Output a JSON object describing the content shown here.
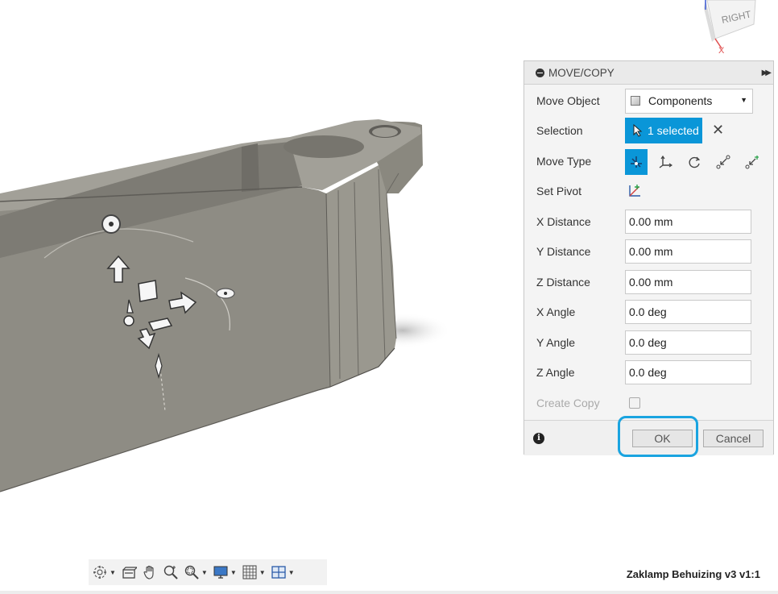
{
  "viewcube": {
    "face_label": "RIGHT",
    "axis_label": "X"
  },
  "dialog": {
    "title": "MOVE/COPY",
    "move_object": {
      "label": "Move Object",
      "value": "Components"
    },
    "selection": {
      "label": "Selection",
      "value": "1 selected"
    },
    "move_type": {
      "label": "Move Type",
      "options": [
        "free-move-icon",
        "translate-icon",
        "rotate-icon",
        "point-to-point-icon",
        "point-to-position-icon"
      ]
    },
    "set_pivot": {
      "label": "Set Pivot"
    },
    "fields": [
      {
        "label": "X Distance",
        "value": "0.00 mm"
      },
      {
        "label": "Y Distance",
        "value": "0.00 mm"
      },
      {
        "label": "Z Distance",
        "value": "0.00 mm"
      },
      {
        "label": "X Angle",
        "value": "0.0 deg"
      },
      {
        "label": "Y Angle",
        "value": "0.0 deg"
      },
      {
        "label": "Z Angle",
        "value": "0.0 deg"
      }
    ],
    "create_copy": {
      "label": "Create Copy",
      "checked": false
    },
    "ok_label": "OK",
    "cancel_label": "Cancel"
  },
  "document_title": "Zaklamp Behuizing v3 v1:1",
  "colors": {
    "accent": "#0a96d8",
    "model": "#8c8a82",
    "highlight": "#1aa4e0"
  }
}
